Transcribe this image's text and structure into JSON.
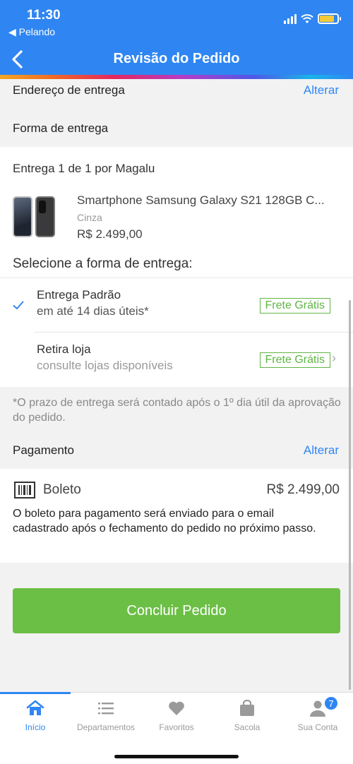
{
  "status": {
    "time": "11:30",
    "back_app": "◀ Pelando"
  },
  "header": {
    "title": "Revisão do Pedido"
  },
  "address": {
    "label": "Endereço de entrega",
    "action": "Alterar"
  },
  "shipping_method": {
    "label": "Forma de entrega"
  },
  "delivery": {
    "heading": "Entrega 1 de 1 por Magalu",
    "product": {
      "name": "Smartphone Samsung Galaxy S21 128GB C...",
      "color": "Cinza",
      "price": "R$ 2.499,00"
    },
    "select_label": "Selecione a forma de entrega:",
    "options": [
      {
        "title": "Entrega Padrão",
        "subtitle": "em até 14 dias úteis*",
        "tag": "Frete Grátis",
        "selected": true
      },
      {
        "title": "Retira loja",
        "subtitle": "consulte lojas disponíveis",
        "tag": "Frete Grátis",
        "selected": false
      }
    ],
    "note": "*O prazo de entrega será contado após o 1º dia útil da aprovação do pedido."
  },
  "payment": {
    "label": "Pagamento",
    "action": "Alterar",
    "method": "Boleto",
    "amount": "R$ 2.499,00",
    "description": "O boleto para pagamento será enviado para o email cadastrado após o fechamento do pedido no próximo passo."
  },
  "cta": {
    "label": "Concluir Pedido"
  },
  "tabs": [
    {
      "label": "Início",
      "icon": "home-icon",
      "active": true
    },
    {
      "label": "Departamentos",
      "icon": "list-icon"
    },
    {
      "label": "Favoritos",
      "icon": "heart-icon"
    },
    {
      "label": "Sacola",
      "icon": "bag-icon"
    },
    {
      "label": "Sua Conta",
      "icon": "user-icon",
      "badge": "7"
    }
  ],
  "colors": {
    "primary": "#2f86f2",
    "success": "#6cbf45",
    "tag_green": "#5fb543"
  }
}
